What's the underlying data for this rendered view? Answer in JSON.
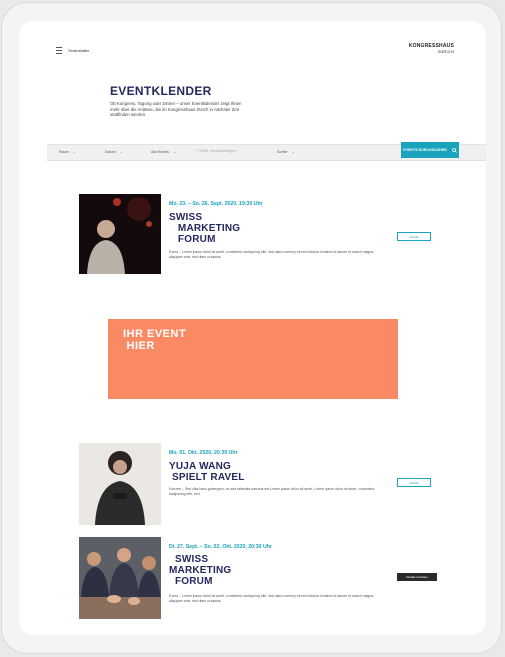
{
  "header": {
    "menu_label": "Veranstalter",
    "logo_line1": "KONGRESSHAUS",
    "logo_line2": "ZÜRICH"
  },
  "page": {
    "title": "EVENTKLENDER",
    "intro": "Ob Kongress, Tagung oder Dinner – unser Eventkalender zeigt Ihnen mehr über die Anlässe, die im Kongresshaus Zürich in nächster Zeit stattfinden werden."
  },
  "filters": {
    "f1": "Raum",
    "f2": "Datum",
    "f3": "Alle Events",
    "f4_placeholder": "TT.MM.  Veranstaltungen",
    "f5": "Sortier",
    "search_label": "EVENTS DURCHSUCHEN"
  },
  "events": [
    {
      "date": "Mo. 23. – So. 26. Sept. 2020, 19:30 Uhr",
      "title": "SWISS\n   MARKETING\n   FORUM",
      "desc": "Event – Lorem ipsum dolor sit amet, consetetur sadipscing elitr, sed diam nonumy eirmod tempor invidunt ut labore et dolore magna aliquyam erat, sed diam voluptua.",
      "button": "Details"
    },
    {
      "date": "Mo. 01. Okt. 2020, 20:30 Uhr",
      "title": "YUJA WANG\n SPIELT RAVEL",
      "desc": "Konzert – Stet clita kasd gubergren, no sea takimata sanctus est Lorem ipsum dolor sit amet. Lorem ipsum dolor sit amet, consetetur sadipscing elitr, sed.",
      "button": "Details"
    },
    {
      "date": "Di. 27. Sept. – So. 02. Okt. 2020, 20:30 Uhr",
      "title": "  SWISS\nMARKETING\n  FORUM",
      "desc": "Event – Lorem ipsum dolor sit amet, consetetur sadipscing elitr, sed diam nonumy eirmod tempor invidunt ut labore et dolore magna aliquyam erat, sed diam voluptua.",
      "button": "Details ansehen"
    }
  ],
  "ad": {
    "text": "IHR EVENT\n HIER"
  },
  "colors": {
    "accent": "#1aa3bd",
    "title": "#25285e",
    "ad_bg": "#f98a63"
  }
}
